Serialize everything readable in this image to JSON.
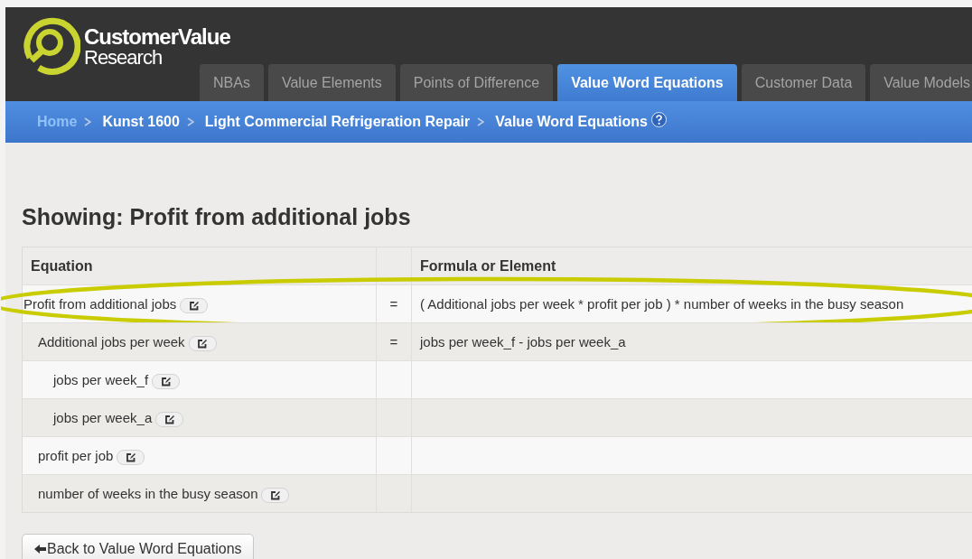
{
  "brand": {
    "name": "CustomerValue",
    "subtitle": "Research"
  },
  "tabs": [
    {
      "label": "NBAs",
      "selected": false
    },
    {
      "label": "Value Elements",
      "selected": false
    },
    {
      "label": "Points of Difference",
      "selected": false
    },
    {
      "label": "Value Word Equations",
      "selected": true
    },
    {
      "label": "Customer Data",
      "selected": false
    },
    {
      "label": "Value Models",
      "selected": false
    }
  ],
  "breadcrumb": [
    {
      "label": "Home",
      "kind": "link"
    },
    {
      "label": "Kunst 1600",
      "kind": "crumb"
    },
    {
      "label": "Light Commercial Refrigeration Repair",
      "kind": "crumb"
    },
    {
      "label": "Value Word Equations",
      "kind": "current"
    }
  ],
  "heading": "Showing: Profit from additional jobs",
  "table": {
    "columns": [
      "Equation",
      "Formula or Element"
    ],
    "rows": [
      {
        "name": "Profit from additional jobs",
        "operator": "=",
        "formula": "( Additional jobs per week * profit per job ) * number of weeks in the busy season",
        "circled": true,
        "children": [
          {
            "name": "Additional jobs per week",
            "operator": "=",
            "formula": "jobs per week_f - jobs per week_a",
            "circled": false,
            "children": [
              {
                "name": "jobs per week_f",
                "circled": false
              },
              {
                "name": "jobs per week_a",
                "circled": false
              }
            ]
          },
          {
            "name": "profit per job",
            "circled": false
          },
          {
            "name": "number of weeks in the busy season",
            "circled": false
          }
        ]
      }
    ]
  },
  "back_button": "Back to Value Word Equations"
}
